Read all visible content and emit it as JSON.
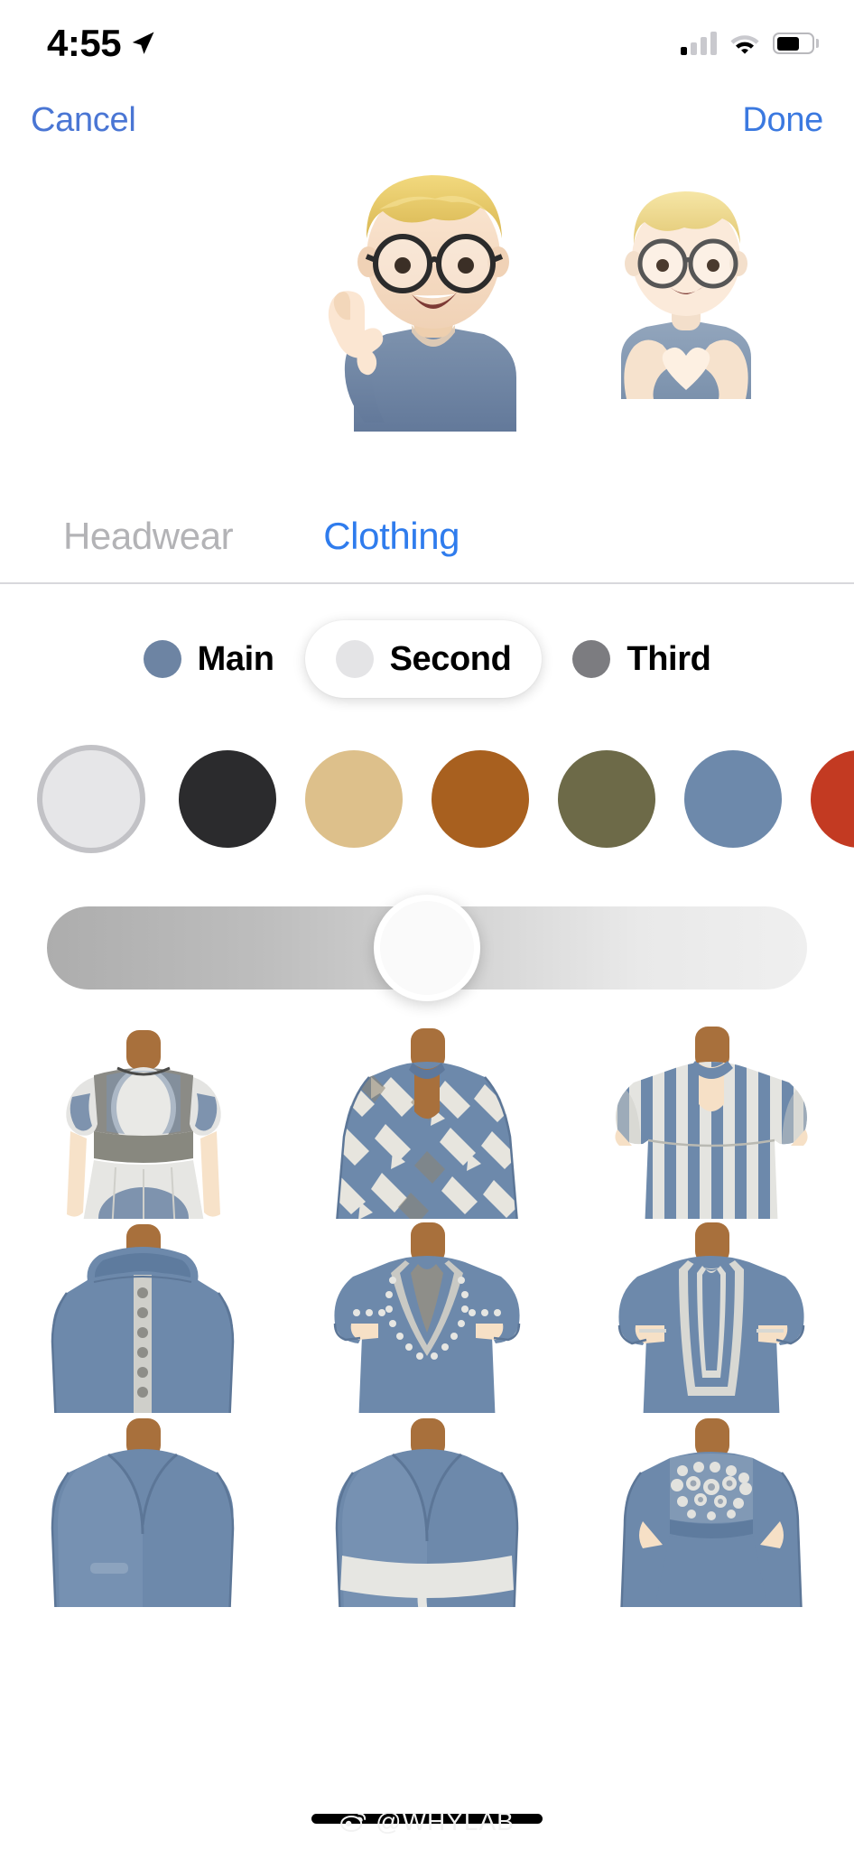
{
  "status_bar": {
    "time": "4:55",
    "location_icon": "location-arrow-icon",
    "signal_icon": "cellular-signal-icon",
    "signal_bars_active": 1,
    "wifi_icon": "wifi-icon",
    "battery_icon": "battery-icon",
    "battery_level_percent": 55
  },
  "nav_bar": {
    "cancel_label": "Cancel",
    "done_label": "Done",
    "tint_color": "#4a76d4"
  },
  "memoji_preview": {
    "primary_pose": "memoji-call-me-hand-pose",
    "secondary_pose": "memoji-heart-hands-pose",
    "hair_color": "#e8c96a",
    "shirt_color": "#6d84a3",
    "skin_color": "#f6dcc6"
  },
  "category_tabs": [
    {
      "label": "Headwear",
      "active": false,
      "color": "#b3b3b6"
    },
    {
      "label": "Clothing",
      "active": true,
      "color": "#2f7ced"
    }
  ],
  "layer_segments": [
    {
      "label": "Main",
      "selected": false,
      "dot_color": "#6d84a3"
    },
    {
      "label": "Second",
      "selected": true,
      "dot_color": "#e4e4e6"
    },
    {
      "label": "Third",
      "selected": false,
      "dot_color": "#7c7c80"
    }
  ],
  "color_swatches": [
    {
      "name": "light-gray",
      "color": "#e6e6e8",
      "selected": true
    },
    {
      "name": "charcoal",
      "color": "#2b2b2d",
      "selected": false
    },
    {
      "name": "tan",
      "color": "#ddc08b",
      "selected": false
    },
    {
      "name": "rust-brown",
      "color": "#a8601f",
      "selected": false
    },
    {
      "name": "olive",
      "color": "#6d6a48",
      "selected": false
    },
    {
      "name": "slate-blue",
      "color": "#6d89ab",
      "selected": false
    },
    {
      "name": "red",
      "color": "#c33a22",
      "selected": false
    }
  ],
  "intensity_slider": {
    "value_percent": 50,
    "gradient_from": "#adadad",
    "gradient_to": "#efefef",
    "thumb_color": "#fafafa"
  },
  "clothing_grid": {
    "garment_color": "#6d89ab",
    "accent_color": "#e2e2e0",
    "neck_color": "#a8703c",
    "skin_color": "#f3ddc4",
    "items": [
      {
        "name": "puff-sleeve-circle-dress",
        "selected": false
      },
      {
        "name": "geometric-print-tunic",
        "selected": false
      },
      {
        "name": "vertical-stripe-kaftan",
        "selected": false
      },
      {
        "name": "hooded-button-sweatshirt",
        "selected": false
      },
      {
        "name": "embroidered-dashiki",
        "selected": false
      },
      {
        "name": "panel-embroidered-tunic",
        "selected": false
      },
      {
        "name": "wrap-robe",
        "selected": false
      },
      {
        "name": "belted-wrap-robe",
        "selected": false
      },
      {
        "name": "beaded-yoke-dress",
        "selected": false
      }
    ]
  },
  "home_indicator": {
    "name": "home-indicator"
  },
  "watermark": {
    "text": "@WHYLAB",
    "icon": "weibo-icon"
  }
}
